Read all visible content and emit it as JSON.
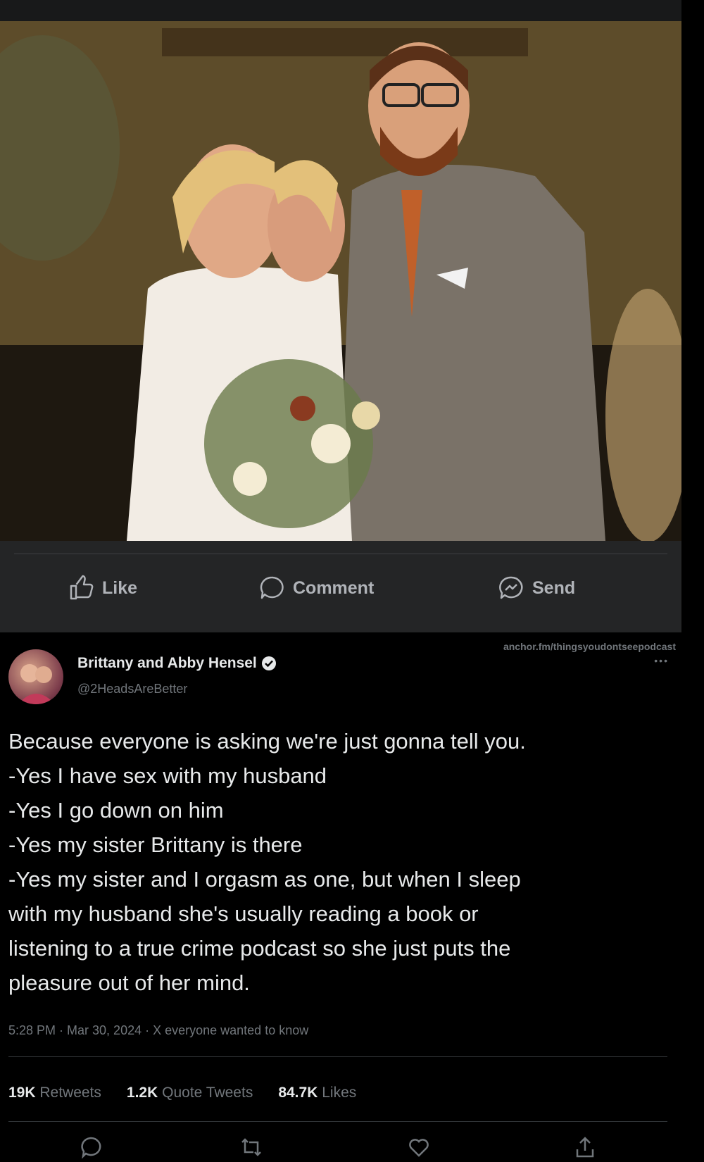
{
  "facebook_actions": {
    "like_label": "Like",
    "comment_label": "Comment",
    "send_label": "Send"
  },
  "tweet": {
    "source_link": "anchor.fm/thingsyoudontseepodcast",
    "more_label": "•••",
    "author_name": "Brittany and Abby Hensel",
    "author_handle": "@2HeadsAreBetter",
    "text_lines": [
      "Because everyone is asking we're just gonna tell you.",
      "-Yes I have sex with my husband",
      "-Yes I go down on him",
      "-Yes my sister Brittany is there",
      "-Yes my sister and I orgasm as one, but when I sleep",
      "with my husband she's usually reading a book or",
      "listening to a true crime podcast so she just puts the",
      "pleasure out of her mind."
    ],
    "meta": "5:28 PM · Mar 30, 2024 · X everyone wanted to know",
    "stats": {
      "retweets_count": "19K",
      "retweets_label": "Retweets",
      "quotes_count": "1.2K",
      "quotes_label": "Quote Tweets",
      "likes_count": "84.7K",
      "likes_label": "Likes"
    }
  },
  "colors": {
    "facebook_bg": "#242526",
    "tweet_bg": "#000000",
    "text_primary": "#e7e9ea",
    "text_secondary": "#71767b",
    "verified_blue": "#1d9bf0"
  }
}
